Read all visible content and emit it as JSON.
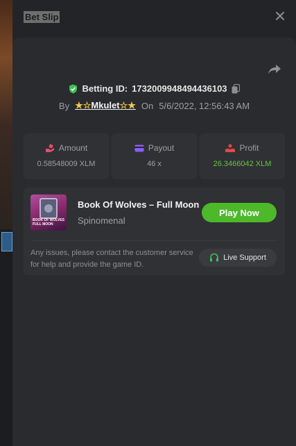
{
  "header": {
    "title": "Bet Slip",
    "close_icon": "close-icon"
  },
  "bet": {
    "id_label": "Betting ID:",
    "id_value": "1732009948494436103",
    "by_label": "By",
    "user": "Mkulet",
    "user_star_left": "★☆",
    "user_star_right": "☆★",
    "on_label": "On",
    "datetime": "5/6/2022, 12:56:43 AM"
  },
  "stats": [
    {
      "label": "Amount",
      "value": "0.58548009 XLM",
      "icon": "hand-coins-icon"
    },
    {
      "label": "Payout",
      "value": "46 x",
      "icon": "wallet-card-icon"
    },
    {
      "label": "Profit",
      "value": "26.3466042 XLM",
      "icon": "profit-hand-icon"
    }
  ],
  "game": {
    "name": "Book Of Wolves – Full Moon",
    "provider": "Spinomenal",
    "play_label": "Play Now",
    "thumb_text_1": "BOOK OF WOLVES",
    "thumb_text_2": "FULL MOON"
  },
  "support": {
    "message": "Any issues, please contact the customer service for help and provide the game ID.",
    "button_label": "Live Support"
  },
  "colors": {
    "accent": "#4db82a",
    "profit": "#66c447",
    "star": "#f6c744",
    "shield": "#3fbf57"
  }
}
